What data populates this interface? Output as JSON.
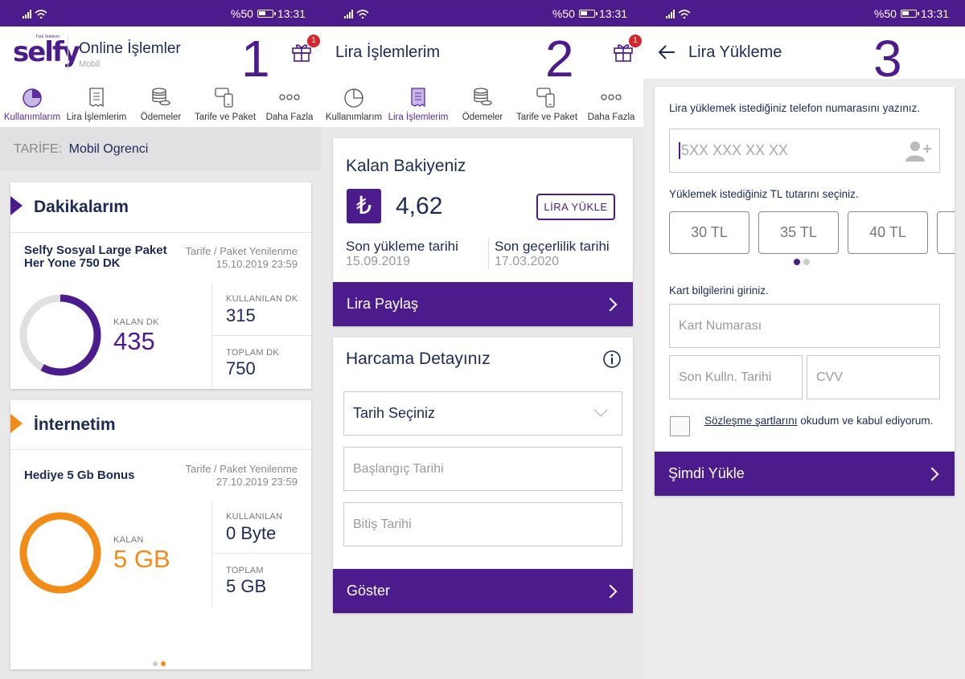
{
  "status": {
    "battery": "%50",
    "time": "13:31"
  },
  "tabs": [
    {
      "label": "Kullanımlarım"
    },
    {
      "label": "Lira İşlemlerim"
    },
    {
      "label": "Ödemeler"
    },
    {
      "label": "Tarife ve Paket"
    },
    {
      "label": "Daha Fazla"
    }
  ],
  "gift_badge": "1",
  "colors": {
    "brand": "#4c1b8c",
    "orange": "#f28c16"
  },
  "screen1": {
    "logo_small": "Türk Telekom",
    "logo": "selfy",
    "title": "Online İşlemler",
    "subtitle": "Mobil",
    "number": "1",
    "tarife_label": "TARİFE:",
    "tarife_value": "Mobil Ogrenci",
    "minutes": {
      "heading": "Dakikalarım",
      "package": "Selfy Sosyal Large Paket Her Yone 750 DK",
      "renew_label": "Tarife / Paket Yenilenme",
      "renew_date": "15.10.2019 23:59",
      "remaining_label": "KALAN DK",
      "remaining": "435",
      "used_label": "KULLANILAN DK",
      "used": "315",
      "total_label": "TOPLAM DK",
      "total": "750",
      "ring_fraction": 0.58
    },
    "internet": {
      "heading": "İnternetim",
      "package": "Hediye 5 Gb Bonus",
      "renew_label": "Tarife / Paket Yenilenme",
      "renew_date": "27.10.2019 23:59",
      "remaining_label": "KALAN",
      "remaining": "5 GB",
      "used_label": "KULLANILAN",
      "used": "0 Byte",
      "total_label": "TOPLAM",
      "total": "5 GB",
      "ring_fraction": 1.0
    }
  },
  "screen2": {
    "title": "Lira İşlemlerim",
    "number": "2",
    "balance_heading": "Kalan Bakiyeniz",
    "lira_symbol": "₺",
    "balance": "4,62",
    "load_button": "LİRA YÜKLE",
    "last_load_label": "Son yükleme tarihi",
    "last_load_date": "15.09.2019",
    "validity_label": "Son geçerlilik tarihi",
    "validity_date": "17.03.2020",
    "share_button": "Lira Paylaş",
    "spending_heading": "Harcama Detayınız",
    "date_select": "Tarih Seçiniz",
    "start_date": "Başlangıç Tarihi",
    "end_date": "Bitiş Tarihi",
    "show_button": "Göster"
  },
  "screen3": {
    "title": "Lira Yükleme",
    "number": "3",
    "phone_prompt": "Lira yüklemek istediğiniz telefon numarasını yazınız.",
    "phone_placeholder": "5XX XXX XX XX",
    "amount_prompt": "Yüklemek istediğiniz TL tutarını seçiniz.",
    "amounts": [
      "30 TL",
      "35 TL",
      "40 TL"
    ],
    "card_prompt": "Kart bilgilerini giriniz.",
    "card_number": "Kart Numarası",
    "expiry": "Son Kulln. Tarihi",
    "cvv": "CVV",
    "terms_link": "Sözleşme şartlarını",
    "terms_rest": " okudum ve kabul ediyorum.",
    "submit": "Şimdi Yükle"
  }
}
